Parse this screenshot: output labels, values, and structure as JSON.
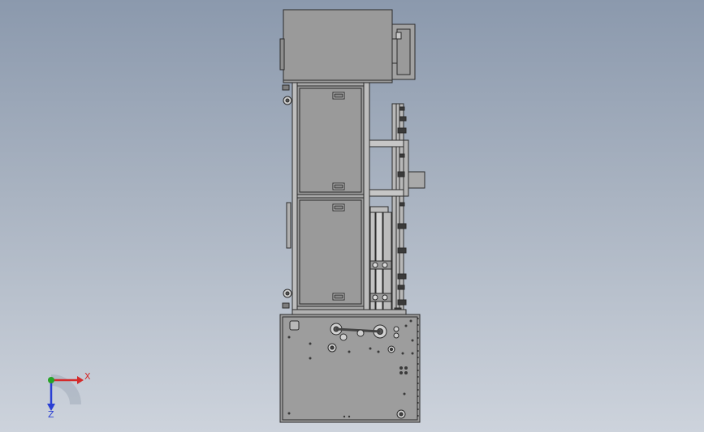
{
  "triad": {
    "x_label": "X",
    "z_label": "Z",
    "colors": {
      "x": "#d42a2a",
      "y": "#27a327",
      "z": "#2a3fd4"
    }
  },
  "model": {
    "view": "side-elevation",
    "colors": {
      "panel": "#9a9a9a",
      "line": "#2b2b2b",
      "background_top": "#8b99ad",
      "background_bottom": "#cdd3dc"
    }
  }
}
